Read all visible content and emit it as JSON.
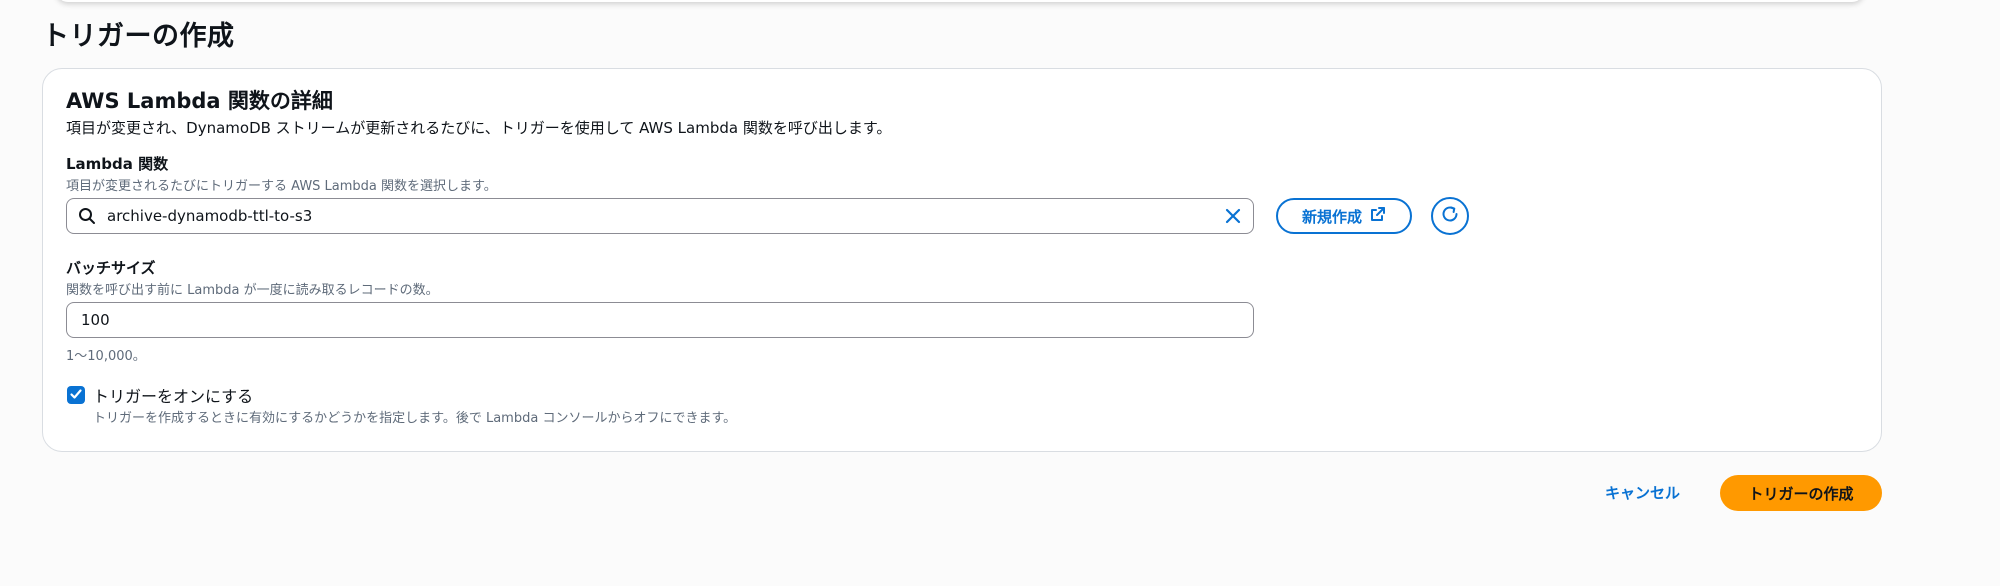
{
  "page": {
    "title": "トリガーの作成"
  },
  "panel": {
    "title": "AWS Lambda 関数の詳細",
    "description": "項目が変更され、DynamoDB ストリームが更新されるたびに、トリガーを使用して AWS Lambda 関数を呼び出します。"
  },
  "lambda": {
    "label": "Lambda 関数",
    "hint": "項目が変更されるたびにトリガーする AWS Lambda 関数を選択します。",
    "value": "archive-dynamodb-ttl-to-s3",
    "create_label": "新規作成"
  },
  "batch": {
    "label": "バッチサイズ",
    "hint": "関数を呼び出す前に Lambda が一度に読み取るレコードの数。",
    "value": "100",
    "constraint": "1〜10,000。"
  },
  "enable": {
    "label": "トリガーをオンにする",
    "description": "トリガーを作成するときに有効にするかどうかを指定します。後で Lambda コンソールからオフにできます。",
    "checked": true
  },
  "actions": {
    "cancel_label": "キャンセル",
    "submit_label": "トリガーの作成"
  },
  "colors": {
    "accent": "#0972d3",
    "primary": "#ff9900",
    "border": "#d9dde2",
    "muted": "#5f6b7a"
  }
}
